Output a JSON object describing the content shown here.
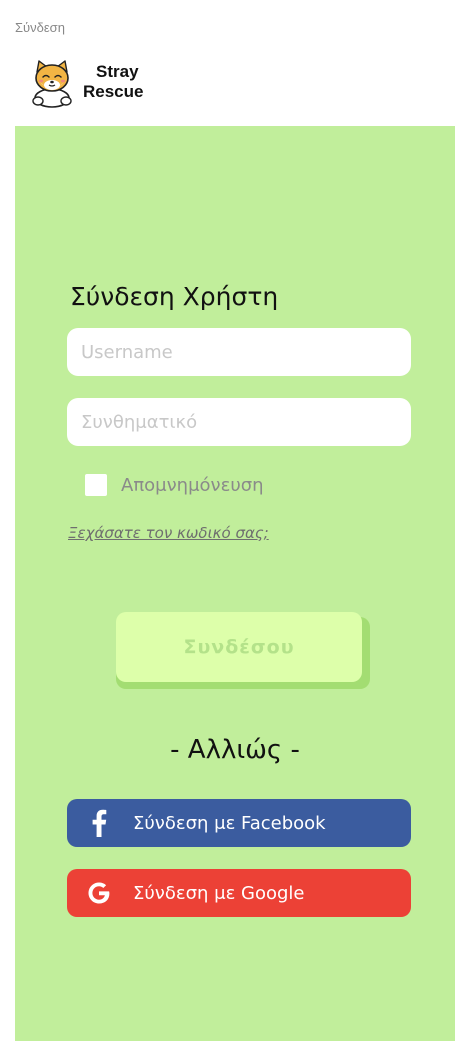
{
  "page": {
    "frame_label": "Σύνδεση"
  },
  "header": {
    "brand_line1": "Stray",
    "brand_line2": "Rescue"
  },
  "login": {
    "title": "Σύνδεση Χρήστη",
    "username_placeholder": "Username",
    "password_placeholder": "Συνθηματικό",
    "remember_label": "Απομνημόνευση",
    "forgot_link": "Ξεχάσατε τον κωδικό σας;",
    "submit_label": "Συνδέσου"
  },
  "alternative": {
    "separator": "- Αλλιώς -",
    "facebook_label": "Σύνδεση με Facebook",
    "google_label": "Σύνδεση με Google"
  },
  "colors": {
    "background": "#c1ee9b",
    "facebook": "#3b5c9f",
    "google": "#ec4136",
    "submit_button": "#ddffaa"
  },
  "icons": [
    "shiba-dog-logo",
    "facebook-icon",
    "google-icon",
    "checkbox"
  ]
}
